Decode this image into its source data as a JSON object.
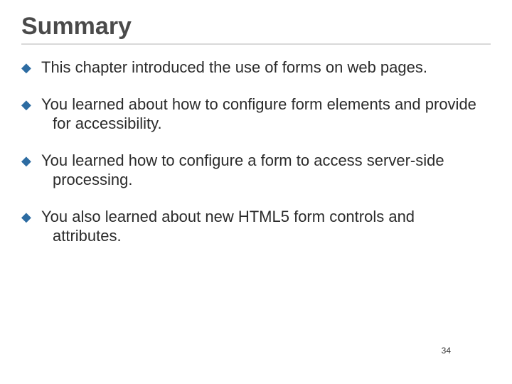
{
  "title": "Summary",
  "bullets": [
    "This chapter introduced the use of forms on web pages.",
    "You learned about how to configure form elements and provide for accessibility.",
    "You learned how to configure a form to access server-side processing.",
    "You also learned about new HTML5 form controls and attributes."
  ],
  "page_number": "34",
  "bullet_glyph": "◆"
}
